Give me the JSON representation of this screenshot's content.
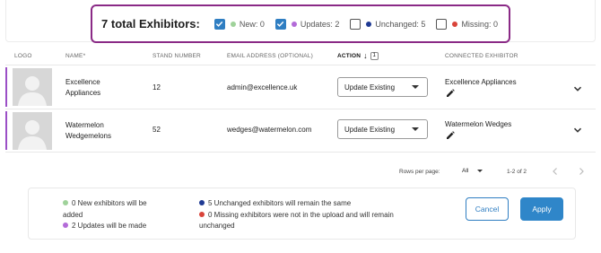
{
  "summary": {
    "title": "7 total Exhibitors:",
    "filters": [
      {
        "label": "New: 0",
        "checked": true,
        "dot_color": "#9fd29a"
      },
      {
        "label": "Updates: 2",
        "checked": true,
        "dot_color": "#b36bd8"
      },
      {
        "label": "Unchanged: 5",
        "checked": false,
        "dot_color": "#1f3a93"
      },
      {
        "label": "Missing: 0",
        "checked": false,
        "dot_color": "#d9443a"
      }
    ]
  },
  "table": {
    "headers": {
      "logo": "LOGO",
      "name": "NAME*",
      "stand": "STAND NUMBER",
      "email": "EMAIL ADDRESS (OPTIONAL)",
      "action": "ACTION",
      "action_sort_badge": "1",
      "connected": "CONNECTED EXHIBITOR"
    },
    "rows": [
      {
        "name_line1": "Excellence",
        "name_line2": "Appliances",
        "stand": "12",
        "email": "admin@excellence.uk",
        "action": "Update Existing",
        "connected": "Excellence Appliances"
      },
      {
        "name_line1": "Watermelon",
        "name_line2": "Wedgemelons",
        "stand": "52",
        "email": "wedges@watermelon.com",
        "action": "Update Existing",
        "connected": "Watermelon Wedges"
      }
    ]
  },
  "pagination": {
    "rows_per_page_label": "Rows per page:",
    "rows_per_page_value": "All",
    "range": "1-2 of 2"
  },
  "footer": {
    "new_line1": "0 New exhibitors will be",
    "new_line2": "added",
    "updates": "2 Updates will be made",
    "unchanged": "5 Unchanged exhibitors will remain the same",
    "missing_line1": "0 Missing exhibitors were not in the upload and will remain",
    "missing_line2": "unchanged",
    "cancel_label": "Cancel",
    "apply_label": "Apply"
  },
  "colors": {
    "accent": "#8a2a86",
    "row_marker": "#9b4fc6",
    "primary": "#2f86c9",
    "new": "#9fd29a",
    "updates": "#b36bd8",
    "unchanged": "#1f3a93",
    "missing": "#d9443a"
  }
}
